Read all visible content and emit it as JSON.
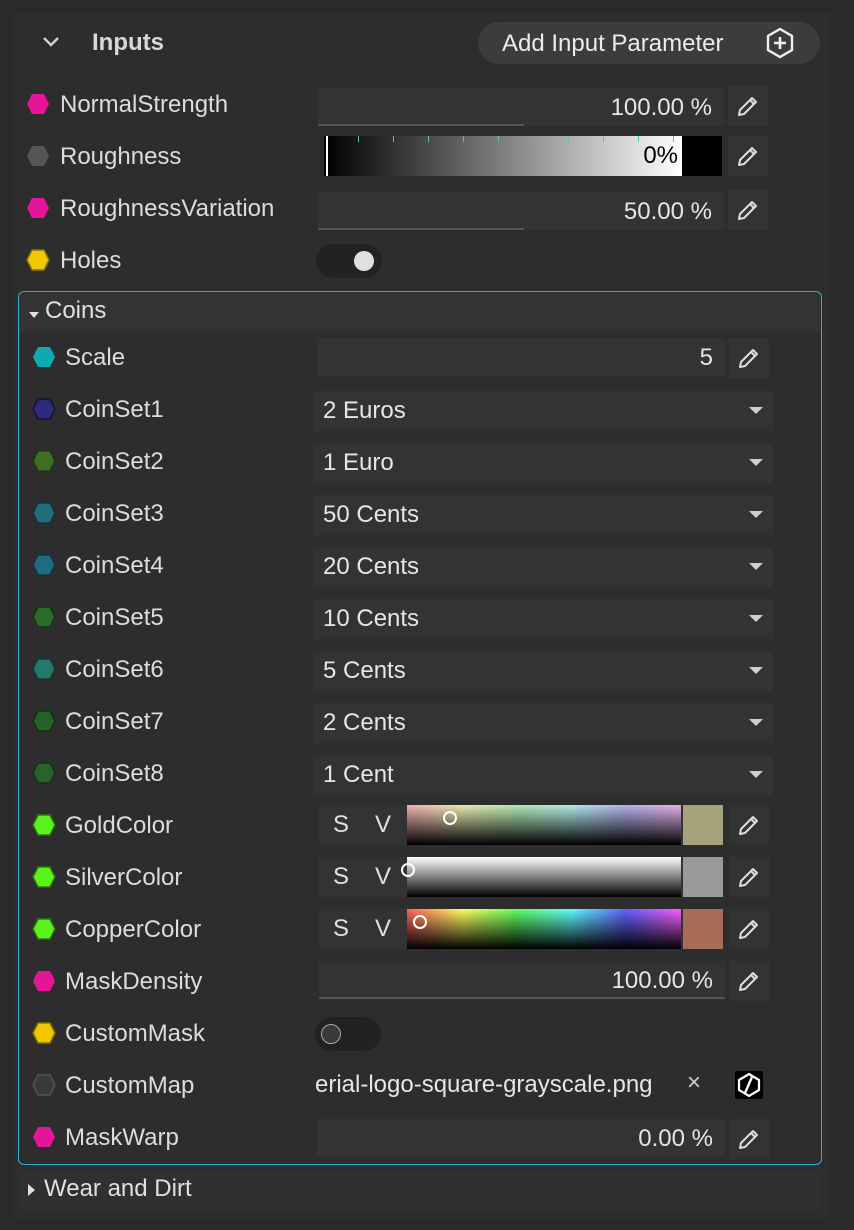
{
  "header": {
    "title": "Inputs",
    "add_button_label": "Add Input Parameter"
  },
  "params": {
    "normal_strength": {
      "label": "NormalStrength",
      "value": "100.00 %"
    },
    "roughness": {
      "label": "Roughness",
      "value": "0%"
    },
    "roughness_variation": {
      "label": "RoughnessVariation",
      "value": "50.00 %"
    },
    "holes": {
      "label": "Holes",
      "on": true
    }
  },
  "coins_group": {
    "title": "Coins",
    "scale": {
      "label": "Scale",
      "value": "5"
    },
    "coinsets": [
      {
        "label": "CoinSet1",
        "value": "2 Euros",
        "color": "#2e2a7a"
      },
      {
        "label": "CoinSet2",
        "value": "1 Euro",
        "color": "#3f6e24"
      },
      {
        "label": "CoinSet3",
        "value": "50 Cents",
        "color": "#236c7c"
      },
      {
        "label": "CoinSet4",
        "value": "20 Cents",
        "color": "#216a82"
      },
      {
        "label": "CoinSet5",
        "value": "10 Cents",
        "color": "#2c6a28"
      },
      {
        "label": "CoinSet6",
        "value": "5 Cents",
        "color": "#237a6a"
      },
      {
        "label": "CoinSet7",
        "value": "2 Cents",
        "color": "#246227"
      },
      {
        "label": "CoinSet8",
        "value": "1 Cent",
        "color": "#28632a"
      }
    ],
    "gold_color": {
      "label": "GoldColor",
      "s": "S",
      "v": "V",
      "swatch": "#a5a27c"
    },
    "silver_color": {
      "label": "SilverColor",
      "s": "S",
      "v": "V",
      "swatch": "#9a9a9a"
    },
    "copper_color": {
      "label": "CopperColor",
      "s": "S",
      "v": "V",
      "swatch": "#a86d57"
    },
    "mask_density": {
      "label": "MaskDensity",
      "value": "100.00 %"
    },
    "custom_mask": {
      "label": "CustomMask",
      "on": false
    },
    "custom_map": {
      "label": "CustomMap",
      "value": "erial-logo-square-grayscale.png",
      "clear": "×"
    },
    "mask_warp": {
      "label": "MaskWarp",
      "value": "0.00 %"
    }
  },
  "wear_group": {
    "title": "Wear and Dirt"
  },
  "colors": {
    "magenta": "#e5159a",
    "gray": "#555555",
    "yellow": "#f0c800",
    "cyan": "#0eaab2",
    "lime": "#5cf21e",
    "accent": "#2ab3d6"
  }
}
